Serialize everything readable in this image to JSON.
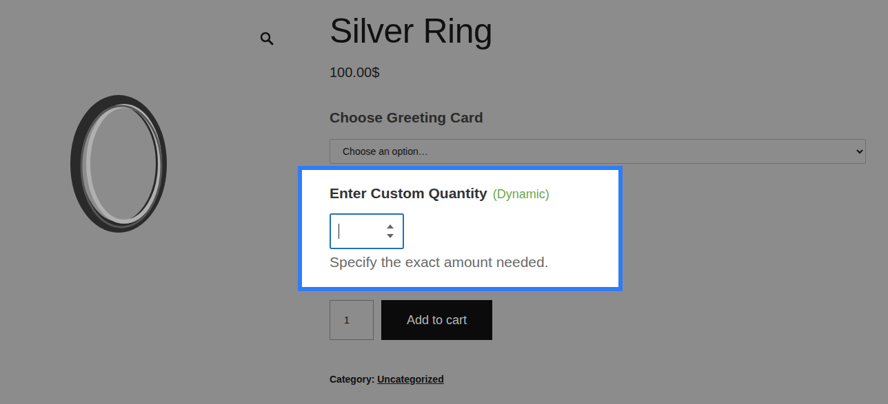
{
  "product": {
    "title": "Silver Ring",
    "price": "100.00$"
  },
  "greeting_card": {
    "label": "Choose Greeting Card",
    "selected_option": "Choose an option…"
  },
  "custom_quantity": {
    "label": "Enter Custom Quantity",
    "tag": "(Dynamic)",
    "help": "Specify the exact amount needed.",
    "highlighted": true,
    "focused": true
  },
  "cart": {
    "quantity": "1",
    "button": "Add to cart"
  },
  "category": {
    "label": "Category:",
    "value": "Uncategorized"
  }
}
